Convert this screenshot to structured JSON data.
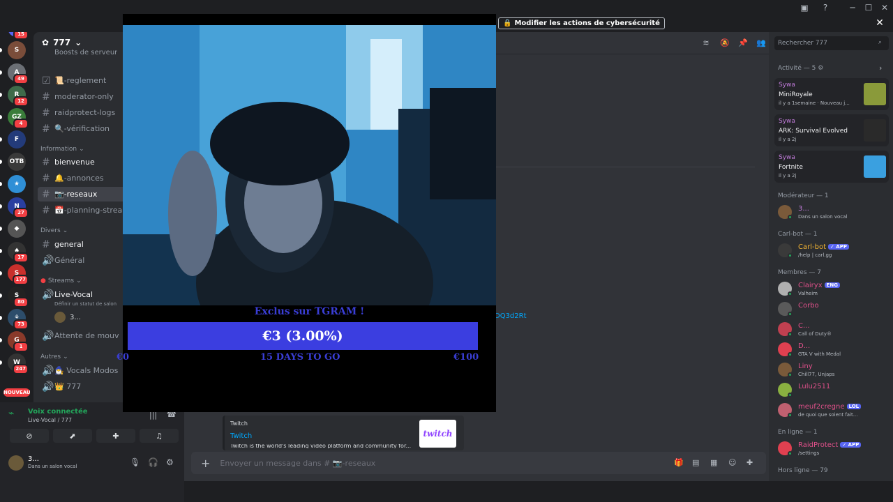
{
  "window": {
    "minimize": "─",
    "maximize": "☐",
    "close": "✕"
  },
  "banner": {
    "button_label": "Modifier les actions de cybersécurité",
    "close": "✕"
  },
  "servers": [
    {
      "label": "🎮",
      "color": "#5865f2",
      "badge": "15"
    },
    {
      "label": "S",
      "color": "#7a4d3a",
      "badge": ""
    },
    {
      "label": "A",
      "color": "#6b6f75",
      "badge": "49"
    },
    {
      "label": "R",
      "color": "#3e6b4a",
      "badge": "12"
    },
    {
      "label": "GZ",
      "color": "#3a7d3a",
      "badge": "4"
    },
    {
      "label": "F",
      "color": "#233b7a",
      "badge": ""
    },
    {
      "label": "OTB",
      "color": "#3a3a3a",
      "badge": ""
    },
    {
      "label": "★",
      "color": "#2f8fd6",
      "badge": ""
    },
    {
      "label": "N",
      "color": "#2a3fa0",
      "badge": "27"
    },
    {
      "label": "◆",
      "color": "#555",
      "badge": ""
    },
    {
      "label": "♠",
      "color": "#333",
      "badge": "17"
    },
    {
      "label": "S",
      "color": "#c9302c",
      "badge": "177"
    },
    {
      "label": "S",
      "color": "#222",
      "badge": "80"
    },
    {
      "label": "⚘",
      "color": "#2d4d6b",
      "badge": "73"
    },
    {
      "label": "G",
      "color": "#8a3a2a",
      "badge": "1"
    },
    {
      "label": "W",
      "color": "#333",
      "badge": "247"
    }
  ],
  "nouveau": "NOUVEAU",
  "server": {
    "name": "777",
    "boost_text": "Boosts de serveur"
  },
  "channels_top": [
    {
      "name": "📜-reglement",
      "icon": "☑"
    },
    {
      "name": "moderator-only",
      "icon": "#"
    },
    {
      "name": "raidprotect-logs",
      "icon": "#"
    },
    {
      "name": "🔍-vérification",
      "icon": "#"
    }
  ],
  "categories": {
    "information": "Information",
    "divers": "Divers",
    "streams": "Streams",
    "autres": "Autres"
  },
  "channels_info": [
    {
      "name": "bienvenue",
      "icon": "#",
      "state": "unread"
    },
    {
      "name": "🔔-annonces",
      "icon": "#",
      "state": ""
    },
    {
      "name": "📷-reseaux",
      "icon": "#",
      "state": "sel"
    },
    {
      "name": "📅-planning-streams",
      "icon": "#",
      "state": ""
    }
  ],
  "channels_divers": [
    {
      "name": "general",
      "icon": "#",
      "state": "unread"
    },
    {
      "name": "Général",
      "icon": "🔊",
      "state": ""
    }
  ],
  "voice_channel": {
    "name": "Live-Vocal",
    "status": "Définir un statut de salon",
    "user": "3..."
  },
  "afk_channel": "Attente de mouv",
  "channels_autres": [
    {
      "name": "🧙‍♂️ Vocals Modos",
      "icon": "🔊"
    },
    {
      "name": "👑 777",
      "icon": "🔊"
    }
  ],
  "voice_panel": {
    "status": "Voix connectée",
    "location": "Live-Vocal / 777"
  },
  "user": {
    "name": "3...",
    "status": "Dans un salon vocal"
  },
  "search_placeholder": "Rechercher 777",
  "composer_placeholder": "Envoyer un message dans # 📷-reseaux",
  "visible_link_fragment": "DQ3d2Rt",
  "embed": {
    "provider": "Twitch",
    "title": "Twitch",
    "desc": "Twitch is the world's leading video platform and community for...",
    "thumb": "twitch"
  },
  "stream": {
    "goal_title": "Exclus sur TGRAM !",
    "goal_value": "€3 (3.00%)",
    "goal_progress": 3,
    "goal_min": "€0",
    "goal_days": "15 DAYS TO GO",
    "goal_max": "€100"
  },
  "activity": {
    "header": "Activité — 5",
    "items": [
      {
        "user": "Sywa",
        "game": "MiniRoyale",
        "time": "il y a 1semaine  ·  Nouveau j...",
        "thumb": "#8a9a3a"
      },
      {
        "user": "Sywa",
        "game": "ARK: Survival Evolved",
        "time": "il y a 2j",
        "thumb": "#2a2a2a"
      },
      {
        "user": "Sywa",
        "game": "Fortnite",
        "time": "il y a 2j",
        "thumb": "#3aa0e0"
      }
    ]
  },
  "member_groups": [
    {
      "title": "Modérateur — 1",
      "members": [
        {
          "name": "3...",
          "sub": "Dans un salon vocal",
          "color": "#c27cdb",
          "tag": ""
        }
      ]
    },
    {
      "title": "Carl-bot — 1",
      "members": [
        {
          "name": "Carl-bot",
          "sub": "/help | carl.gg",
          "color": "#f0b232",
          "tag": "✓ APP"
        }
      ]
    },
    {
      "title": "Membres — 7",
      "members": [
        {
          "name": "Clairyx",
          "sub": "Valheim",
          "color": "#e0508a",
          "tag": "ENG"
        },
        {
          "name": "Corbo",
          "sub": "",
          "color": "#e0508a",
          "tag": ""
        },
        {
          "name": "C...",
          "sub": "Call of Duty®",
          "color": "#e0508a",
          "tag": ""
        },
        {
          "name": "D...",
          "sub": "GTA V with Medal",
          "color": "#e0508a",
          "tag": ""
        },
        {
          "name": "Liny",
          "sub": "Chill77, Unjaps",
          "color": "#e0508a",
          "tag": ""
        },
        {
          "name": "Lulu2511",
          "sub": "",
          "color": "#e0508a",
          "tag": ""
        },
        {
          "name": "meuf2cregne",
          "sub": "de quoi que soient fait...",
          "color": "#e0508a",
          "tag": "LOL"
        }
      ]
    },
    {
      "title": "En ligne — 1",
      "members": [
        {
          "name": "RaidProtect",
          "sub": "/settings",
          "color": "#e0508a",
          "tag": "✓ APP"
        }
      ]
    },
    {
      "title": "Hors ligne — 79",
      "members": []
    }
  ]
}
